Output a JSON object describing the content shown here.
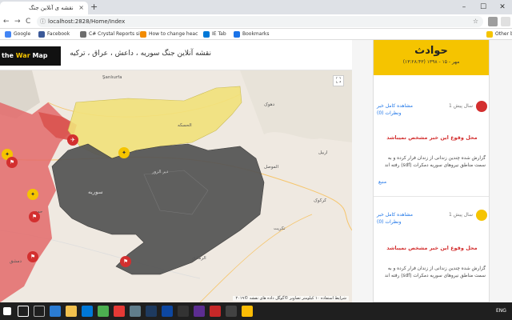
{
  "browser": {
    "tab_title": "نقشه ی آنلاین جنگ",
    "tab_close": "×",
    "new_tab": "+",
    "win_minimize": "–",
    "win_maximize": "☐",
    "win_close": "✕",
    "back": "←",
    "forward": "→",
    "reload": "C",
    "info_icon": "ⓘ",
    "url": "localhost:2828/Home/Index",
    "star": "☆",
    "bookmarks": [
      {
        "label": "Google",
        "color": "#4285f4"
      },
      {
        "label": "Facebook",
        "color": "#3b5998"
      },
      {
        "label": "C# Crystal Reports si",
        "color": "#6d6d6d"
      },
      {
        "label": "How to change heac",
        "color": "#f28b00"
      },
      {
        "label": "IE Tab",
        "color": "#0078d7"
      },
      {
        "label": "Bookmarks",
        "color": "#1a73e8"
      },
      {
        "label": "Other bo",
        "color": "#f5c400"
      }
    ]
  },
  "site": {
    "logo_text_1": "the",
    "logo_text_2": "War",
    "logo_text_3": "Map",
    "title": "نقشه آنلاین جنگ سوریه ، داعش ، عراق ، ترکیه"
  },
  "map": {
    "fullscreen": "⛶",
    "attribution": "شرایط استفاده   ۱۰ کیلومتر   تصاویر ©گوگل داده های نقشه ©۲۰۱۹",
    "labels": [
      {
        "text": "Şanlıurfa"
      },
      {
        "text": "سوریه"
      },
      {
        "text": "الموصل"
      },
      {
        "text": "کرکوک"
      },
      {
        "text": "دهوک"
      },
      {
        "text": "اربیل"
      },
      {
        "text": "تکریت"
      },
      {
        "text": "الرمادی"
      },
      {
        "text": "دیر الزور"
      },
      {
        "text": "الحسکه"
      },
      {
        "text": "حمص"
      },
      {
        "text": "دمشق"
      }
    ],
    "colors": {
      "yellow": "#f2e27a",
      "gray": "#5a5a5a",
      "red": "#e36a6a"
    }
  },
  "sidebar": {
    "title": "حوادث",
    "date": "مهر - ۱۵ - ۱۳۹۸ (۱۳:۲۸:۴۳)",
    "items": [
      {
        "ago": "سال پیش 1",
        "link": "مشاهده کامل خبر ونظرات (0)",
        "place": "محل وقوع این خبر مشخص نمیباشد",
        "text": "گزارش شده چندین زندانی از زندان فرار کرده و به سمت مناطق نیروهای سوریه دمکرات (sdf) رفته اند",
        "source": "منبع",
        "badge_color": "#d32f2f"
      },
      {
        "ago": "سال پیش 1",
        "link": "مشاهده کامل خبر ونظرات (0)",
        "place": "محل وقوع این خبر مشخص نمیباشد",
        "text": "گزارش شده چندین زندانی از زندان فرار کرده و به سمت مناطق نیروهای سوریه دمکرات (sdf) رفته اند",
        "source": "منبع",
        "badge_color": "#f5c400"
      }
    ]
  },
  "taskbar": {
    "lang": "ENG",
    "time": ""
  }
}
